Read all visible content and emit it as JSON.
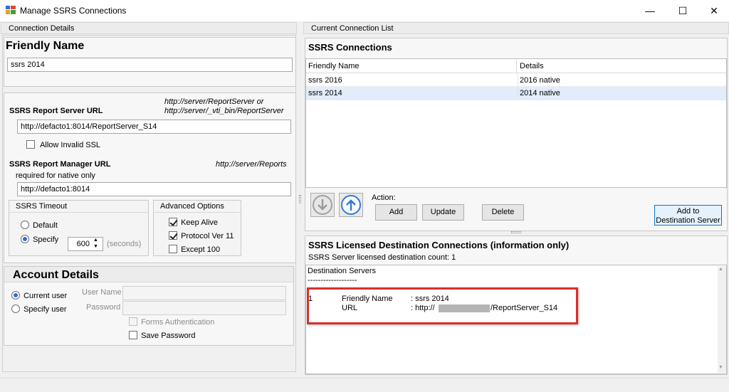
{
  "window": {
    "title": "Manage SSRS Connections",
    "minimize": "—",
    "maximize": "☐",
    "close": "✕"
  },
  "left": {
    "header": "Connection Details",
    "friendly_name_title": "Friendly Name",
    "friendly_name_value": "ssrs 2014",
    "report_server": {
      "label": "SSRS Report Server URL",
      "hint_line1": "http://server/ReportServer or",
      "hint_line2": "http://server/_vti_bin/ReportServer",
      "value": "http://defacto1:8014/ReportServer_S14",
      "allow_invalid_ssl": "Allow Invalid SSL"
    },
    "report_manager": {
      "label": "SSRS Report Manager URL",
      "hint": "http://server/Reports",
      "sub": "required for native only",
      "value": "http://defacto1:8014"
    },
    "timeout": {
      "title": "SSRS Timeout",
      "default_label": "Default",
      "specify_label": "Specify",
      "value": "600",
      "unit": "(seconds)"
    },
    "advanced": {
      "title": "Advanced Options",
      "keep_alive": "Keep Alive",
      "protocol": "Protocol Ver 11",
      "except": "Except 100"
    },
    "account": {
      "title": "Account Details",
      "current_user": "Current user",
      "specify_user": "Specify user",
      "user_name": "User Name",
      "password": "Password",
      "forms_auth": "Forms Authentication",
      "save_password": "Save Password"
    }
  },
  "right": {
    "header": "Current Connection List",
    "connections_title": "SSRS Connections",
    "columns": [
      "Friendly Name",
      "Details"
    ],
    "rows": [
      {
        "name": "ssrs 2016",
        "details": "2016 native"
      },
      {
        "name": "ssrs 2014",
        "details": "2014 native"
      }
    ],
    "action_label": "Action:",
    "add_label": "Add",
    "update_label": "Update",
    "delete_label": "Delete",
    "add_dest_line1": "Add to",
    "add_dest_line2": "Destination Server",
    "licensed_title": "SSRS Licensed Destination Connections (information only)",
    "licensed_count": "SSRS Server licensed destination count:  1",
    "dest_header": "Destination Servers",
    "dest_rule": "-------------------",
    "dest_index": "1",
    "dest_fn_label": "Friendly Name",
    "dest_fn_value": ": ssrs 2014",
    "dest_url_label": "URL",
    "dest_url_prefix": ": http://",
    "dest_url_suffix": "/ReportServer_S14"
  },
  "colors": {
    "selected_row": "#e3ecfa",
    "highlight_box": "#d9302c",
    "accent": "#0078d7"
  }
}
